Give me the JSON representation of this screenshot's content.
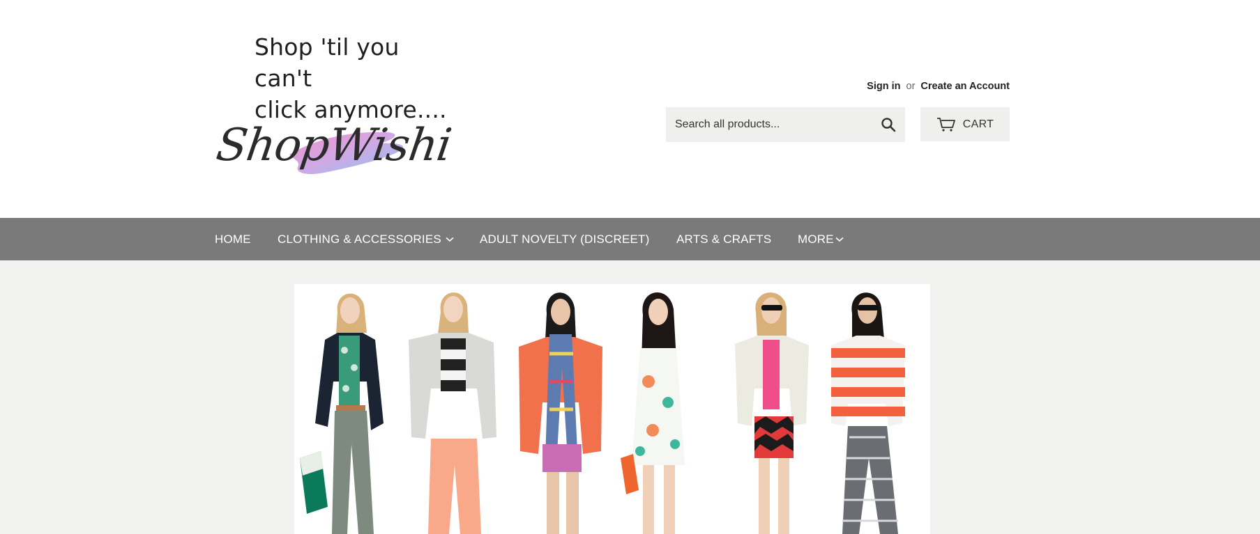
{
  "header": {
    "tagline": "Shop 'til you can't\nclick anymore....",
    "logo_text": "ShopWishi",
    "account": {
      "sign_in": "Sign in",
      "or": "or",
      "create_account": "Create an Account"
    },
    "search": {
      "placeholder": "Search all products...",
      "icon": "search-icon"
    },
    "cart": {
      "label": "CART",
      "icon": "cart-icon"
    }
  },
  "nav": {
    "items": [
      {
        "label": "HOME"
      },
      {
        "label": "CLOTHING & ACCESSORIES",
        "dropdown": true
      },
      {
        "label": "ADULT NOVELTY (DISCREET)"
      },
      {
        "label": "ARTS & CRAFTS"
      },
      {
        "label": "MORE",
        "dropdown": true
      }
    ]
  },
  "hero": {
    "description": ""
  },
  "colors": {
    "nav_bg": "#7a7a7a",
    "body_bg": "#f2f3f1",
    "control_bg": "#eff0ee",
    "text_dark": "#222222"
  }
}
